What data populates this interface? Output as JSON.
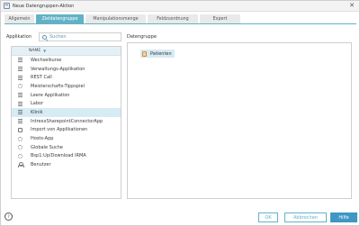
{
  "window": {
    "title": "Neue Datengruppen-Aktion",
    "close_glyph": "✕"
  },
  "tabs": [
    {
      "label": "Allgemein",
      "active": false
    },
    {
      "label": "Zieldatengruppe",
      "active": true
    },
    {
      "label": "Manipulationsmenge",
      "active": false
    },
    {
      "label": "Feldzuordnung",
      "active": false
    },
    {
      "label": "Expert",
      "active": false
    }
  ],
  "left": {
    "label": "Applikation",
    "search_placeholder": "Suchen",
    "column_header": "NAME",
    "sort_glyph": "▼",
    "items": [
      {
        "label": "Wechselkurse",
        "icon": "list-icon",
        "selected": false
      },
      {
        "label": "Verwaltungs-Applikation",
        "icon": "list-icon",
        "selected": false
      },
      {
        "label": "REST Call",
        "icon": "list-icon",
        "selected": false
      },
      {
        "label": "Meisterschafts-Tippspiel",
        "icon": "gear-icon",
        "selected": false
      },
      {
        "label": "Leere Applikation",
        "icon": "list-icon",
        "selected": false
      },
      {
        "label": "Labor",
        "icon": "list-icon",
        "selected": false
      },
      {
        "label": "Klinik",
        "icon": "list-icon",
        "selected": true
      },
      {
        "label": "IntrexxSharepointConnectorApp",
        "icon": "list-icon",
        "selected": false
      },
      {
        "label": "Import von Applikationen",
        "icon": "box-icon",
        "selected": false
      },
      {
        "label": "Hosts-App",
        "icon": "gear-icon",
        "selected": false
      },
      {
        "label": "Globale Suche",
        "icon": "gear-icon",
        "selected": false
      },
      {
        "label": "Bsp1:Up/Download IRMA",
        "icon": "gear-icon",
        "selected": false
      },
      {
        "label": "Benutzer",
        "icon": "user-icon",
        "selected": false
      }
    ]
  },
  "right": {
    "label": "Datengruppe",
    "items": [
      {
        "label": "Patienten",
        "icon": "database-icon"
      }
    ]
  },
  "footer": {
    "help_icon_glyph": "?",
    "ok_label": "OK",
    "cancel_label": "Abbrechen",
    "help_label": "Hilfe"
  },
  "colors": {
    "accent": "#62b2c6",
    "primary_button": "#3f97c4",
    "selection": "#d6ebf4"
  }
}
